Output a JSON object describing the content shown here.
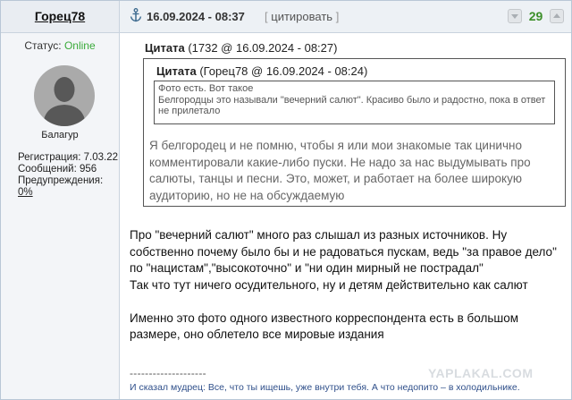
{
  "author": {
    "name": "Горец78",
    "status_label": "Статус:",
    "status_value": "Online",
    "title": "Балагур",
    "registration": "Регистрация: 7.03.22",
    "messages": "Сообщений: 956",
    "warnings_label": "Предупреждения:",
    "warnings_value": "0%"
  },
  "post": {
    "date": "16.09.2024 - 08:37",
    "quote_button": "цитировать",
    "bracket_open": "[",
    "bracket_close": "]",
    "rating": "29"
  },
  "quote_outer": {
    "title": "Цитата",
    "meta": "(1732 @ 16.09.2024 - 08:27)",
    "text": "Я белгородец и не помню, чтобы я или мои знакомые так цинично комментировали какие-либо пуски. Не надо за нас выдумывать про салюты, танцы и песни. Это, может, и работает на более широкую аудиторию, но не на обсуждаемую"
  },
  "quote_inner": {
    "title": "Цитата",
    "meta": "(Горец78 @ 16.09.2024 - 08:24)",
    "text": "Фото есть. Вот такое\nБелгородцы это называли \"вечерний салют\". Красиво было и радостно, пока в ответ не прилетало"
  },
  "message": {
    "p1": "Про \"вечерний салют\" много раз слышал из разных источников. Ну собственно почему было бы и не радоваться пускам, ведь \"за правое дело\" по \"нацистам\",\"высокоточно\" и \"ни один мирный не пострадал\"",
    "p2": "Так что тут ничего осудительного, ну и детям действительно как салют",
    "p3": "Именно это фото одного известного корреспондента есть в большом размере, оно облетело все мировые издания"
  },
  "signature": {
    "line": "--------------------",
    "text": "И сказал мудрец: Все, что ты ищешь, уже внутри тебя. А что недопито – в холодильнике."
  },
  "watermark": "YAPLAKAL.COM",
  "colors": {
    "online": "#3aaa3a",
    "rating": "#3c8f2a",
    "signature": "#2f4f8a"
  }
}
